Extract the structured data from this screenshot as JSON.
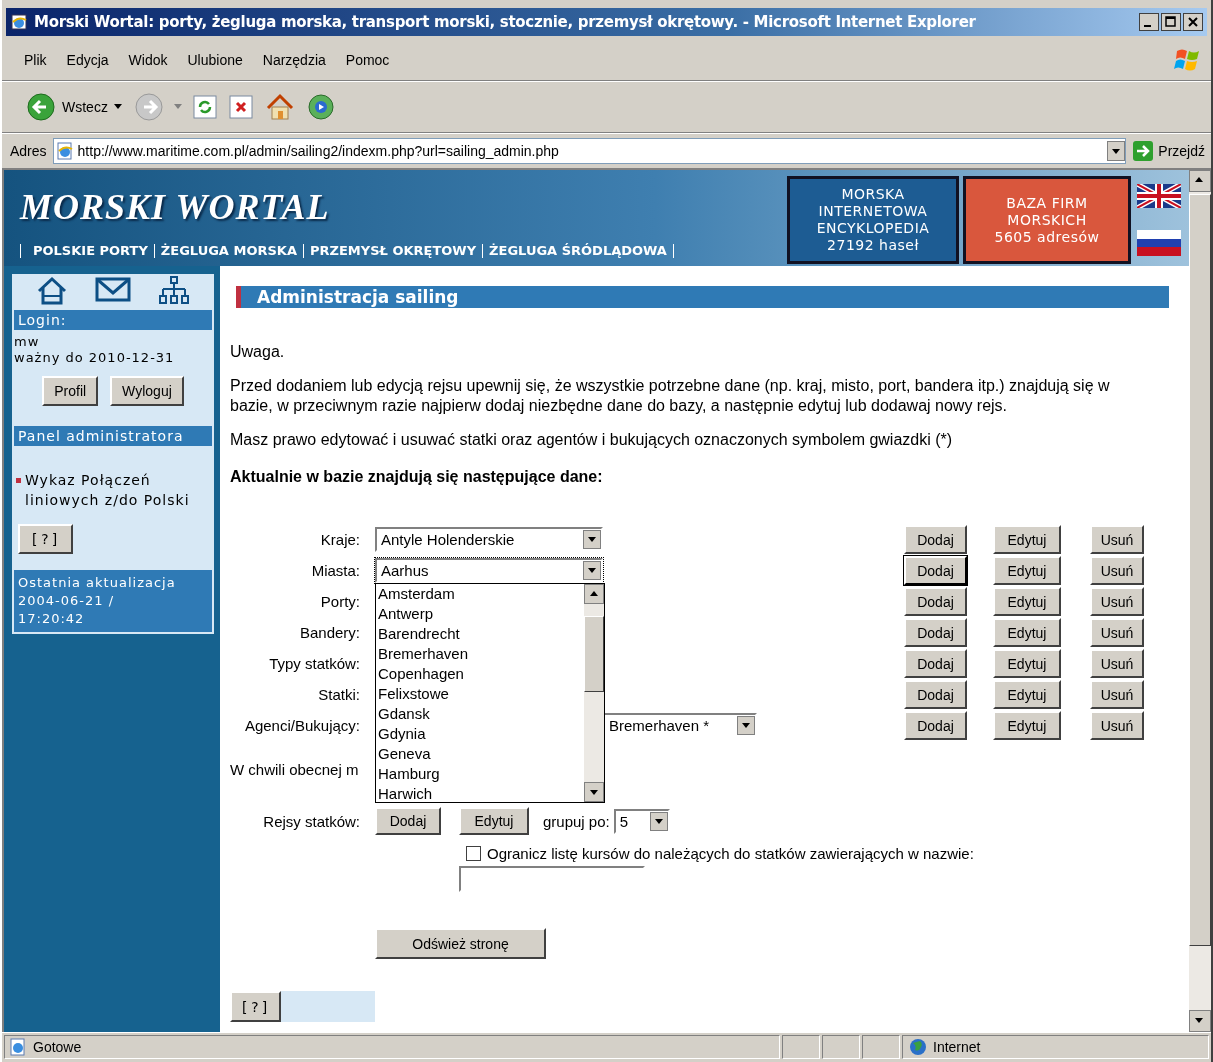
{
  "window": {
    "title": "Morski Wortal: porty, żegluga morska, transport morski, stocznie, przemysł okrętowy. - Microsoft Internet Explorer"
  },
  "menu": [
    "Plik",
    "Edycja",
    "Widok",
    "Ulubione",
    "Narzędzia",
    "Pomoc"
  ],
  "toolbar": {
    "back": "Wstecz"
  },
  "address": {
    "label": "Adres",
    "url": "http://www.maritime.com.pl/admin/sailing2/indexm.php?url=sailing_admin.php",
    "go": "Przejdź"
  },
  "header": {
    "logo": "MORSKI WORTAL",
    "nav": [
      "POLSKIE PORTY",
      "ŻEGLUGA MORSKA",
      "PRZEMYSŁ OKRĘTOWY",
      "ŻEGLUGA ŚRÓDLĄDOWA"
    ],
    "promos": [
      {
        "lines": [
          "MORSKA",
          "INTERNETOWA",
          "ENCYKLOPEDIA",
          "27192 haseł"
        ],
        "color": "#1d5c93"
      },
      {
        "lines": [
          "BAZA FIRM",
          "MORSKICH",
          "5605 adresów"
        ],
        "color": "#d9573d"
      }
    ]
  },
  "sidebar": {
    "login_heading": "Login:",
    "user": "mw",
    "valid": "ważny do 2010-12-31",
    "buttons": [
      "Profil",
      "Wyloguj"
    ],
    "panel_heading": "Panel administratora",
    "links": [
      "Wykaz Połączeń liniowych z/do Polski"
    ],
    "help": "[?]",
    "update_lines": [
      "Ostatnia aktualizacja",
      "2004-06-21 /",
      "17:20:42"
    ]
  },
  "content": {
    "heading": "Administracja sailing",
    "paragraphs": [
      "Uwaga.",
      "Przed dodaniem lub edycją rejsu upewnij się, że wszystkie potrzebne dane (np. kraj, misto, port, bandera itp.) znajdują się w bazie, w przeciwnym razie najpierw dodaj niezbędne dane do bazy, a następnie edytuj lub dodawaj nowy rejs.",
      "Masz prawo edytować i usuwać statki oraz agentów i bukujących oznaczonych symbolem gwiazdki (*)"
    ],
    "subheading": "Aktualnie w bazie znajdują się następujące dane:",
    "rows": [
      {
        "label": "Kraje:",
        "value": "Antyle Holenderskie",
        "buttons": [
          {
            "label": "Dodaj",
            "focused": false
          },
          {
            "label": "Edytuj",
            "focused": false
          },
          {
            "label": "Usuń",
            "focused": false
          }
        ]
      },
      {
        "label": "Miasta:",
        "value": "Aarhus",
        "open": true,
        "options": [
          "Amsterdam",
          "Antwerp",
          "Barendrecht",
          "Bremerhaven",
          "Copenhagen",
          "Felixstowe",
          "Gdansk",
          "Gdynia",
          "Geneva",
          "Hamburg",
          "Harwich"
        ],
        "buttons": [
          {
            "label": "Dodaj",
            "focused": true
          },
          {
            "label": "Edytuj",
            "focused": false
          },
          {
            "label": "Usuń",
            "focused": false
          }
        ]
      },
      {
        "label": "Porty:",
        "buttons": [
          {
            "label": "Dodaj",
            "focused": false
          },
          {
            "label": "Edytuj",
            "focused": false
          },
          {
            "label": "Usuń",
            "focused": false
          }
        ]
      },
      {
        "label": "Bandery:",
        "buttons": [
          {
            "label": "Dodaj",
            "focused": false
          },
          {
            "label": "Edytuj",
            "focused": false
          },
          {
            "label": "Usuń",
            "focused": false
          }
        ]
      },
      {
        "label": "Typy statków:",
        "buttons": [
          {
            "label": "Dodaj",
            "focused": false
          },
          {
            "label": "Edytuj",
            "focused": false
          },
          {
            "label": "Usuń",
            "focused": false
          }
        ]
      },
      {
        "label": "Statki:",
        "buttons": [
          {
            "label": "Dodaj",
            "focused": false
          },
          {
            "label": "Edytuj",
            "focused": false
          },
          {
            "label": "Usuń",
            "focused": false
          }
        ]
      },
      {
        "label": "Agenci/Bukujący:",
        "value": "Bremerhaven *",
        "buttons": [
          {
            "label": "Dodaj",
            "focused": false
          },
          {
            "label": "Edytuj",
            "focused": false
          },
          {
            "label": "Usuń",
            "focused": false
          }
        ]
      }
    ],
    "notice": "W chwili obecnej m",
    "voyages": {
      "label": "Rejsy statków:",
      "buttons": [
        "Dodaj",
        "Edytuj"
      ],
      "group_label": "grupuj po:",
      "group_value": "5"
    },
    "filter": {
      "label": "Ogranicz listę kursów do należących do statków zawierających w nazwie:",
      "checked": false
    },
    "refresh": "Odśwież stronę",
    "help": "[?]"
  },
  "status_bar": {
    "text": "Gotowe",
    "zone": "Internet"
  }
}
